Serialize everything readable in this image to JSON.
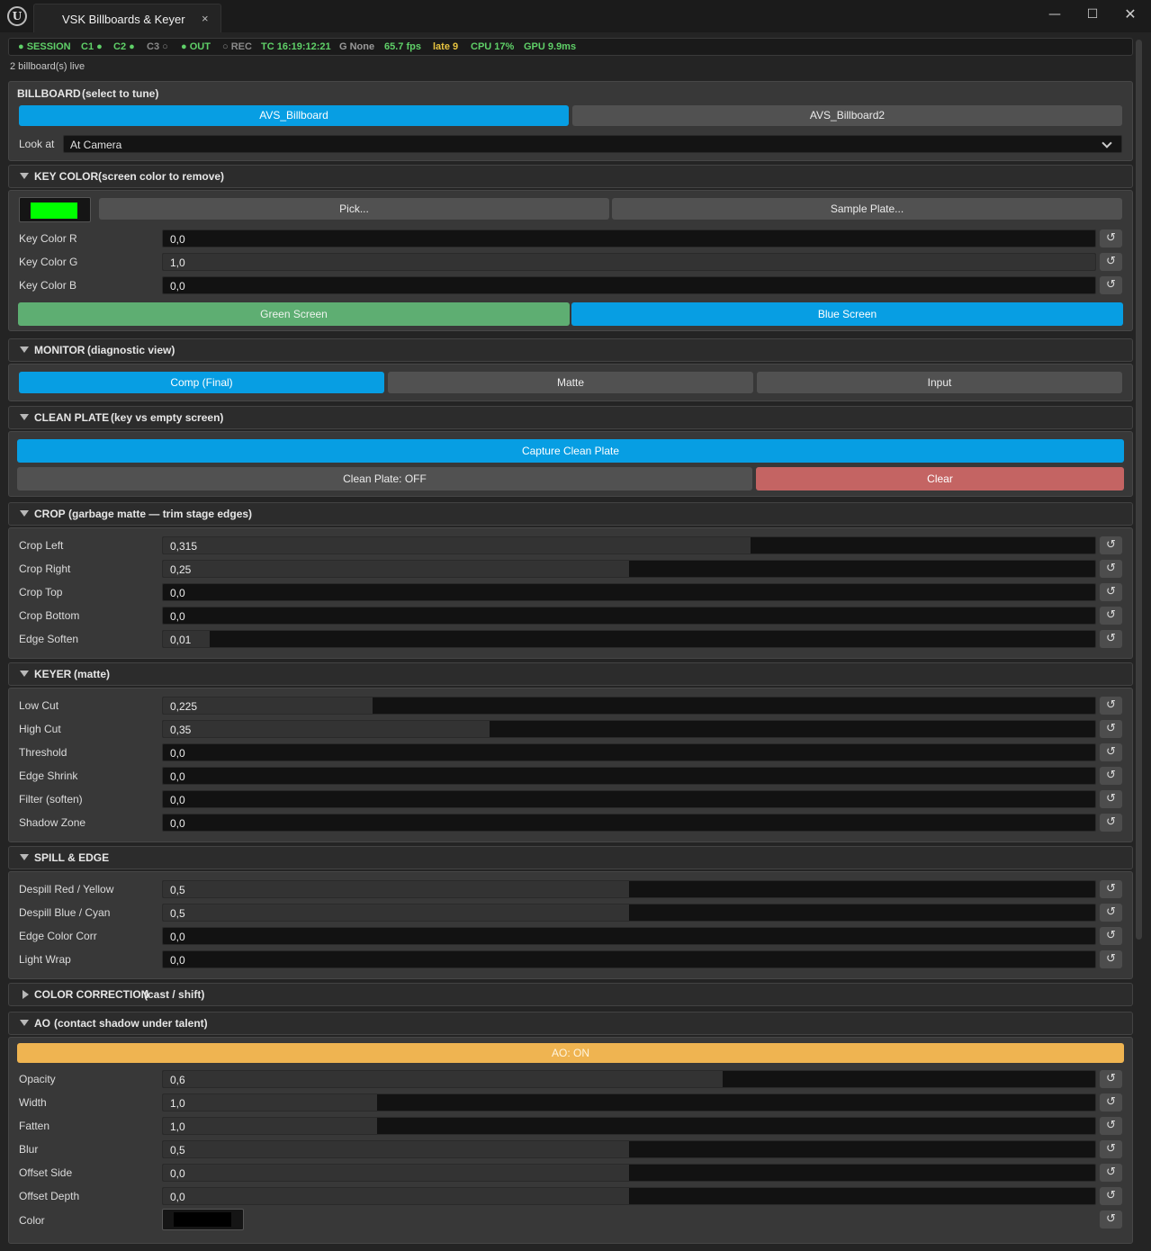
{
  "window": {
    "tab_title": "VSK Billboards & Keyer",
    "tab_close": "×",
    "min": "—",
    "max": "☐",
    "close": "✕",
    "logo": "U"
  },
  "status": [
    {
      "text": "● SESSION",
      "color": "#5fd068"
    },
    {
      "text": "C1 ●",
      "color": "#5fd068"
    },
    {
      "text": "C2 ●",
      "color": "#5fd068"
    },
    {
      "text": "C3 ○",
      "color": "#8a8a8a"
    },
    {
      "text": "● OUT",
      "color": "#5fd068"
    },
    {
      "text": "○ REC",
      "color": "#8a8a8a"
    },
    {
      "text": "TC 16:19:12:21",
      "color": "#5fd068"
    },
    {
      "text": "G None",
      "color": "#9a9a9a"
    },
    {
      "text": "65.7 fps",
      "color": "#5fd068"
    },
    {
      "text": "late 9",
      "color": "#e8c440"
    },
    {
      "text": "CPU 17%",
      "color": "#5fd068"
    },
    {
      "text": "GPU 9.9ms",
      "color": "#5fd068"
    }
  ],
  "live_count": "2 billboard(s) live",
  "billboard": {
    "title": "BILLBOARD",
    "subtitle": "(select to tune)",
    "items": [
      "AVS_Billboard",
      "AVS_Billboard2"
    ],
    "selected": 0,
    "look_at_label": "Look at",
    "look_at_value": "At Camera"
  },
  "key_color": {
    "title": "KEY COLOR",
    "subtitle": "(screen color to remove)",
    "swatch_color": "#00ff00",
    "pick": "Pick...",
    "sample_plate": "Sample Plate...",
    "rows": [
      {
        "label": "Key Color  R",
        "value": "0,0",
        "fill": 0
      },
      {
        "label": "Key Color  G",
        "value": "1,0",
        "fill": 1
      },
      {
        "label": "Key Color  B",
        "value": "0,0",
        "fill": 0
      }
    ],
    "green_screen": "Green Screen",
    "blue_screen": "Blue Screen"
  },
  "monitor": {
    "title": "MONITOR",
    "subtitle": "(diagnostic view)",
    "options": [
      "Comp (Final)",
      "Matte",
      "Input"
    ],
    "selected": 0
  },
  "clean_plate": {
    "title": "CLEAN PLATE",
    "subtitle": "(key vs empty screen)",
    "capture": "Capture Clean Plate",
    "state": "Clean Plate: OFF",
    "clear": "Clear"
  },
  "crop": {
    "title": "CROP",
    "subtitle": "(garbage matte — trim stage edges)",
    "rows": [
      {
        "label": "Crop  Left",
        "value": "0,315",
        "fill": 0.63
      },
      {
        "label": "Crop  Right",
        "value": "0,25",
        "fill": 0.5
      },
      {
        "label": "Crop  Top",
        "value": "0,0",
        "fill": 0
      },
      {
        "label": "Crop  Bottom",
        "value": "0,0",
        "fill": 0
      },
      {
        "label": "Edge Soften",
        "value": "0,01",
        "fill": 0.05
      }
    ]
  },
  "keyer": {
    "title": "KEYER",
    "subtitle": "(matte)",
    "rows": [
      {
        "label": "Low Cut",
        "value": "0,225",
        "fill": 0.225
      },
      {
        "label": "High Cut",
        "value": "0,35",
        "fill": 0.35
      },
      {
        "label": "Threshold",
        "value": "0,0",
        "fill": 0
      },
      {
        "label": "Edge Shrink",
        "value": "0,0",
        "fill": 0
      },
      {
        "label": "Filter (soften)",
        "value": "0,0",
        "fill": 0
      },
      {
        "label": "Shadow Zone",
        "value": "0,0",
        "fill": 0
      }
    ]
  },
  "spill": {
    "title": "SPILL & EDGE",
    "rows": [
      {
        "label": "Despill  Red / Yellow",
        "value": "0,5",
        "fill": 0.5
      },
      {
        "label": "Despill  Blue / Cyan",
        "value": "0,5",
        "fill": 0.5
      },
      {
        "label": "Edge Color Corr",
        "value": "0,0",
        "fill": 0
      },
      {
        "label": "Light Wrap",
        "value": "0,0",
        "fill": 0
      }
    ]
  },
  "color_correction": {
    "title": "COLOR CORRECTION",
    "subtitle": "(cast / shift)"
  },
  "ao": {
    "title": "AO",
    "subtitle": "(contact shadow under talent)",
    "toggle": "AO: ON",
    "rows": [
      {
        "label": "Opacity",
        "value": "0,6",
        "fill": 0.6
      },
      {
        "label": "Width",
        "value": "1,0",
        "fill": 0.23
      },
      {
        "label": "Fatten",
        "value": "1,0",
        "fill": 0.23
      },
      {
        "label": "Blur",
        "value": "0,5",
        "fill": 0.5
      },
      {
        "label": "Offset  Side",
        "value": "0,0",
        "fill": 0.5
      },
      {
        "label": "Offset  Depth",
        "value": "0,0",
        "fill": 0.5
      }
    ],
    "color_label": "Color",
    "color_value": "#000000"
  },
  "icons": {
    "reset": "↺"
  }
}
